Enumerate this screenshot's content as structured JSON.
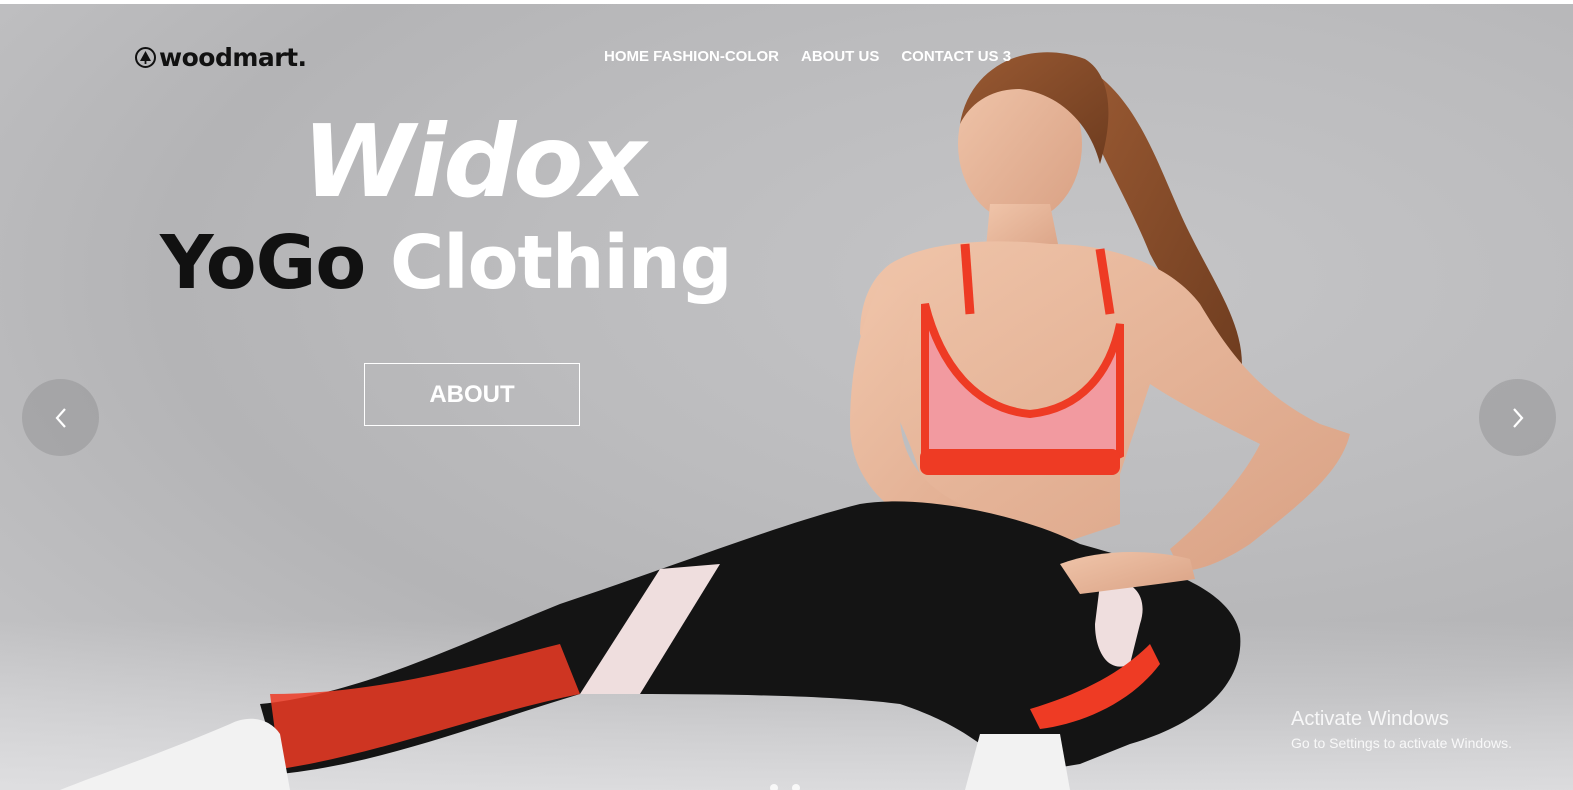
{
  "header": {
    "logo_text": "woodmart.",
    "logo_icon": "tree-icon",
    "nav": [
      {
        "label": "HOME FASHION-COLOR"
      },
      {
        "label": "ABOUT US"
      },
      {
        "label": "CONTACT US 3"
      }
    ]
  },
  "hero": {
    "title_line1": "Widox",
    "title_line2_dark": "YoGo",
    "title_line2_light": "Clothing",
    "button_label": "ABOUT",
    "prev_icon": "chevron-left-icon",
    "next_icon": "chevron-right-icon",
    "image": "woman-yoga-stretch-photo"
  },
  "watermark": {
    "line1": "Activate Windows",
    "line2": "Go to Settings to activate Windows."
  },
  "colors": {
    "background": "#bdbdbf",
    "accent_red": "#ee3b24",
    "bra_pink": "#f29aa0",
    "leggings": "#141414",
    "text_light": "#ffffff",
    "text_dark": "#111111"
  }
}
